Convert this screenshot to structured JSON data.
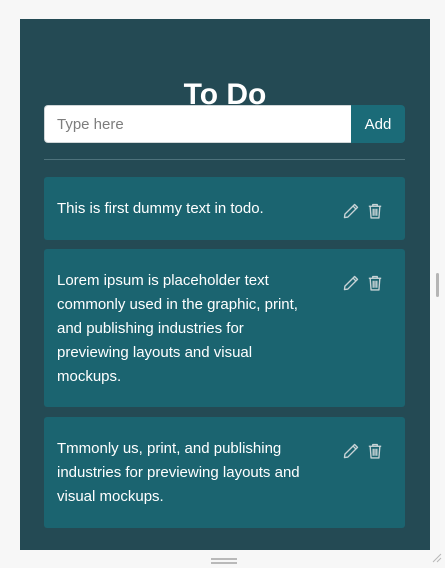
{
  "app": {
    "title": "To Do"
  },
  "input": {
    "placeholder": "Type here",
    "value": ""
  },
  "add_button": {
    "label": "Add"
  },
  "todos": [
    {
      "text": "This is first dummy text in todo.",
      "edit_icon": "pencil-icon",
      "delete_icon": "trash-icon"
    },
    {
      "text": "Lorem ipsum is placeholder text commonly used in the graphic, print, and publishing industries for previewing layouts and visual mockups.",
      "edit_icon": "pencil-icon",
      "delete_icon": "trash-icon"
    },
    {
      "text": "Tmmonly us, print, and publishing industries for previewing layouts and visual mockups.",
      "edit_icon": "pencil-icon",
      "delete_icon": "trash-icon"
    }
  ],
  "colors": {
    "panel_bg": "#244a54",
    "item_bg": "#1b6470",
    "button_bg": "#1b6b78",
    "text": "#ffffff",
    "icon": "#c8d3d6"
  }
}
